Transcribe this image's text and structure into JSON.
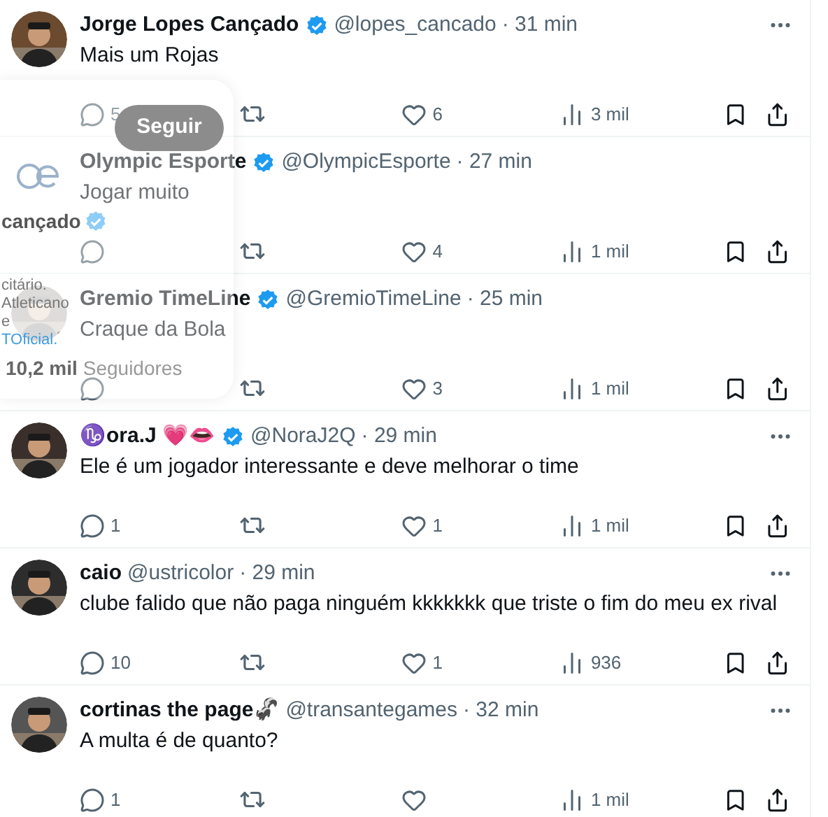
{
  "tweets": [
    {
      "name": "Jorge Lopes Cançado",
      "verified": true,
      "handle": "@lopes_cancado",
      "time": "· 31 min",
      "text": "Mais um Rojas",
      "menu": true,
      "replies": "5",
      "likes": "6",
      "views": "3 mil"
    },
    {
      "name": "Olympic Esporte",
      "verified": true,
      "handle": "@OlympicEsporte",
      "time": "· 27 min",
      "text": "Jogar muito",
      "avatar": {
        "kind": "logo"
      },
      "menu": false,
      "likes": "4",
      "views": "1 mil"
    },
    {
      "name": "Gremio TimeLine",
      "verified": true,
      "handle": "@GremioTimeLine",
      "time": "· 25 min",
      "text": "Craque da Bola",
      "menu": false,
      "likes": "3",
      "views": "1 mil"
    },
    {
      "name": "♑ora.J 💗👄",
      "verified": true,
      "handle": "@NoraJ2Q",
      "time": "· 29 min",
      "text": "Ele é um jogador interessante e deve melhorar o time",
      "menu": true,
      "replies": "1",
      "likes": "1",
      "views": "1 mil"
    },
    {
      "name": "caio",
      "verified": false,
      "handle": "@ustricolor",
      "time": "· 29 min",
      "text": "clube falido que não paga ninguém kkkkkkk que triste o fim do meu ex rival",
      "menu": true,
      "replies": "10",
      "likes": "1",
      "views": "936"
    },
    {
      "name": "cortinas the page🦨",
      "verified": false,
      "handle": "@transantegames",
      "time": "· 32 min",
      "text": "A multa é de quanto?",
      "menu": true,
      "replies": "1",
      "views": "1 mil"
    }
  ],
  "hover_card": {
    "follow_button": "Seguir",
    "name": "cançado",
    "verified": true,
    "bio_line_1": "citário. Atleticano e",
    "bio_link": "TOficial.",
    "followers_count": "10,2 mil",
    "followers_label": "Seguidores"
  }
}
